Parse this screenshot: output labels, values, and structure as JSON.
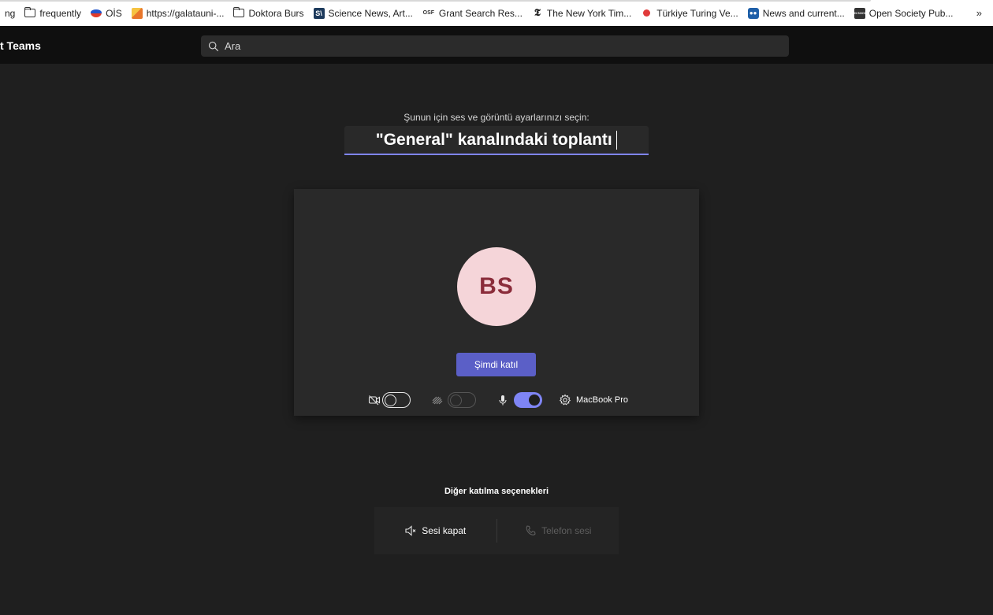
{
  "bookmarks": {
    "items": [
      {
        "label": "ng",
        "icon": "none"
      },
      {
        "label": "frequently",
        "icon": "folder-icon"
      },
      {
        "label": "OİS",
        "icon": "ois-icon"
      },
      {
        "label": "https://galatauni-...",
        "icon": "galata-icon"
      },
      {
        "label": "Doktora Burs",
        "icon": "folder-icon"
      },
      {
        "label": "Science News, Art...",
        "icon": "sciencenews-icon"
      },
      {
        "label": "Grant Search Res...",
        "icon": "osf-icon"
      },
      {
        "label": "The New York Tim...",
        "icon": "nyt-icon"
      },
      {
        "label": "Türkiye Turing Ve...",
        "icon": "turing-icon"
      },
      {
        "label": "News and current...",
        "icon": "news-icon"
      },
      {
        "label": "Open Society Pub...",
        "icon": "open-society-icon"
      }
    ],
    "icon_text": {
      "sn": "S\\",
      "osf": "OSF",
      "nyt": "𝕿",
      "news": "●●",
      "osp": "OPEN SOCIETY"
    },
    "more": "»"
  },
  "topbar": {
    "app_title": "t Teams",
    "search_placeholder": "Ara"
  },
  "prejoin": {
    "subtitle": "Şunun için ses ve görüntü ayarlarınızı seçin:",
    "meeting_name": "\"General\" kanalındaki toplantı",
    "avatar_initials": "BS",
    "join_button": "Şimdi katıl",
    "camera_on": false,
    "background_effects_on": false,
    "microphone_on": true,
    "device_label": "MacBook Pro"
  },
  "other_options": {
    "title": "Diğer katılma seçenekleri",
    "mute_audio": "Sesi kapat",
    "phone_audio": "Telefon sesi"
  },
  "colors": {
    "accent": "#5b5fc7",
    "accent_light": "#7f85f5",
    "avatar_bg": "#f5d5d9",
    "avatar_text": "#8a2c3a",
    "background": "#1f1f1f"
  }
}
